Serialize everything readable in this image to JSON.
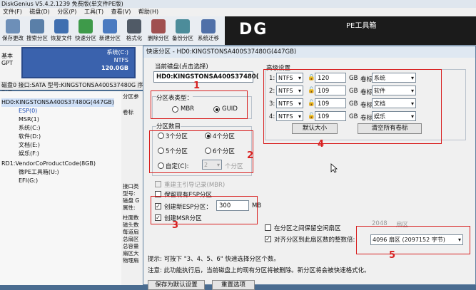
{
  "window": {
    "title": "DiskGenius V5.4.2.1239 免费版(单文件PE版)"
  },
  "menu": [
    "文件(F)",
    "磁盘(D)",
    "分区(P)",
    "工具(T)",
    "查看(V)",
    "帮助(H)"
  ],
  "toolbar": [
    {
      "label": "保存更改",
      "icon": "save-icon"
    },
    {
      "label": "搜索分区",
      "icon": "search-partition-icon"
    },
    {
      "label": "恢复文件",
      "icon": "recover-file-icon"
    },
    {
      "label": "快速分区",
      "icon": "quick-partition-icon"
    },
    {
      "label": "新建分区",
      "icon": "new-partition-icon"
    },
    {
      "label": "格式化",
      "icon": "format-icon"
    },
    {
      "label": "删除分区",
      "icon": "delete-partition-icon"
    },
    {
      "label": "备份分区",
      "icon": "backup-partition-icon"
    },
    {
      "label": "系统迁移",
      "icon": "system-migrate-icon"
    }
  ],
  "banner": {
    "text1": "DG",
    "text2": "PE工具箱"
  },
  "disk_map": {
    "line1": "基本",
    "line2": "GPT",
    "part_name": "系统(C:)",
    "part_fs": "NTFS",
    "part_size": "120.0GB"
  },
  "disk_info": "磁盘0 接口:SATA 型号:KINGSTONSA400S37480G 序列号",
  "tree": [
    "HD0:KINGSTONSA400S37480G(447GB)",
    "ESP(0)",
    "MSR(1)",
    "系统(C:)",
    "软件(D:)",
    "文档(E:)",
    "娱乐(F:)",
    "RD1:VendorCoProductCode(8GB)",
    "微PE工具箱(U:)",
    "EFI(G:)"
  ],
  "mid_labels": [
    "分区参",
    "卷标",
    "",
    "",
    "",
    "",
    "",
    "",
    "",
    "",
    "",
    "",
    "接口类",
    "型号:",
    "磁盘 G",
    "属性:",
    "",
    "柱面数",
    "磁头数",
    "每道扇",
    "总扇区",
    "总容量",
    "扇区大",
    "物理扇"
  ],
  "dialog": {
    "title": "快速分区 - HD0:KINGSTONSA400S37480G(447GB)",
    "current_disk_label": "当前磁盘(点击选择)",
    "current_disk_value": "HD0:KINGSTONSA400S37480(",
    "pt_type_label": "分区表类型：",
    "mbr": "MBR",
    "guid": "GUID",
    "count_label": "分区数目",
    "counts": [
      "3个分区",
      "4个分区",
      "5个分区",
      "6个分区"
    ],
    "custom_label": "自定(C):",
    "custom_value": "2",
    "custom_unit": "个分区",
    "rebuild_mbr": "重建主引导记录(MBR)",
    "keep_esp": "保留现有ESP分区",
    "create_esp": "创建新ESP分区：",
    "esp_size": "300",
    "esp_unit": "MB",
    "create_msr": "创建MSR分区",
    "advanced_label": "高级设置",
    "partitions": [
      {
        "index": "1:",
        "fs": "NTFS",
        "size": "120",
        "unit": "GB",
        "vol_label": "卷标:",
        "name": "系统"
      },
      {
        "index": "2:",
        "fs": "NTFS",
        "size": "109",
        "unit": "GB",
        "vol_label": "卷标:",
        "name": "软件"
      },
      {
        "index": "3:",
        "fs": "NTFS",
        "size": "109",
        "unit": "GB",
        "vol_label": "卷标:",
        "name": "文档"
      },
      {
        "index": "4:",
        "fs": "NTFS",
        "size": "109",
        "unit": "GB",
        "vol_label": "卷标:",
        "name": "娱乐"
      }
    ],
    "default_size_btn": "默认大小",
    "clear_labels_btn": "清空所有卷标",
    "keep_free": "在分区之间保留空闲扇区",
    "free_value": "2048",
    "free_unit": "扇区",
    "align_label": "对齐分区到此扇区数的整数倍:",
    "align_value": "4096 扇区 (2097152 字节)",
    "tip": "提示: 可按下 \"3、4、5、6\" 快速选择分区个数。",
    "note": "注意: 此功能执行后，当前磁盘上的现有分区将被删除。新分区将会被快速格式化。",
    "btn_save": "保存为默认设置",
    "btn_reset": "重置选项"
  },
  "annotations": [
    "1",
    "2",
    "3",
    "4",
    "5"
  ],
  "colors": {
    "accent_red": "#d82020",
    "partition_blue": "#3a62ad"
  }
}
